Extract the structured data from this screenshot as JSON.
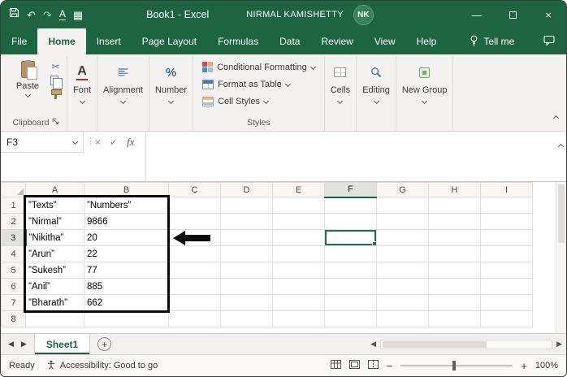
{
  "window": {
    "title": "Book1 - Excel",
    "user_name": "NIRMAL KAMISHETTY",
    "avatar_initials": "NK"
  },
  "icons": {
    "undo": "↶",
    "redo": "↷",
    "underline_letter": "A",
    "qat_grid": "▦",
    "minimize": "—",
    "close": "×",
    "cut": "✂",
    "font_letter": "A",
    "percent": "%",
    "splitter": "⋮",
    "cancel": "×",
    "enter": "✓",
    "fx": "fx",
    "nav_left": "◀",
    "nav_right": "▶",
    "add_sheet": "+",
    "zoom_out": "−",
    "zoom_in": "+"
  },
  "tabs": {
    "items": [
      "File",
      "Home",
      "Insert",
      "Page Layout",
      "Formulas",
      "Data",
      "Review",
      "View",
      "Help"
    ],
    "tell_me_label": "Tell me"
  },
  "ribbon": {
    "paste_label": "Paste",
    "groups": {
      "clipboard": "Clipboard",
      "font": "Font",
      "alignment": "Alignment",
      "number": "Number",
      "styles": "Styles",
      "cells": "Cells",
      "editing": "Editing",
      "new_group": "New Group"
    },
    "styles_buttons": {
      "conditional_formatting": "Conditional Formatting",
      "format_as_table": "Format as Table",
      "cell_styles": "Cell Styles"
    }
  },
  "formula_bar": {
    "name_box": "F3"
  },
  "grid": {
    "col_headers": [
      "A",
      "B",
      "C",
      "D",
      "E",
      "F",
      "G",
      "H",
      "I"
    ],
    "row_headers": [
      "1",
      "2",
      "3",
      "4",
      "5",
      "6",
      "7",
      "8"
    ],
    "selected_cell": "F3",
    "cells": [
      [
        "”Texts”",
        "”Numbers”"
      ],
      [
        "”Nirmal”",
        "9866"
      ],
      [
        "”Nikitha”",
        "20"
      ],
      [
        "”Arun”",
        "22"
      ],
      [
        "”Sukesh”",
        "77"
      ],
      [
        "”Anil”",
        "885"
      ],
      [
        "”Bharath”",
        "662"
      ]
    ]
  },
  "sheet_bar": {
    "sheet_name": "Sheet1"
  },
  "status_bar": {
    "ready": "Ready",
    "accessibility": "Accessibility: Good to go",
    "zoom_level": "100%"
  }
}
